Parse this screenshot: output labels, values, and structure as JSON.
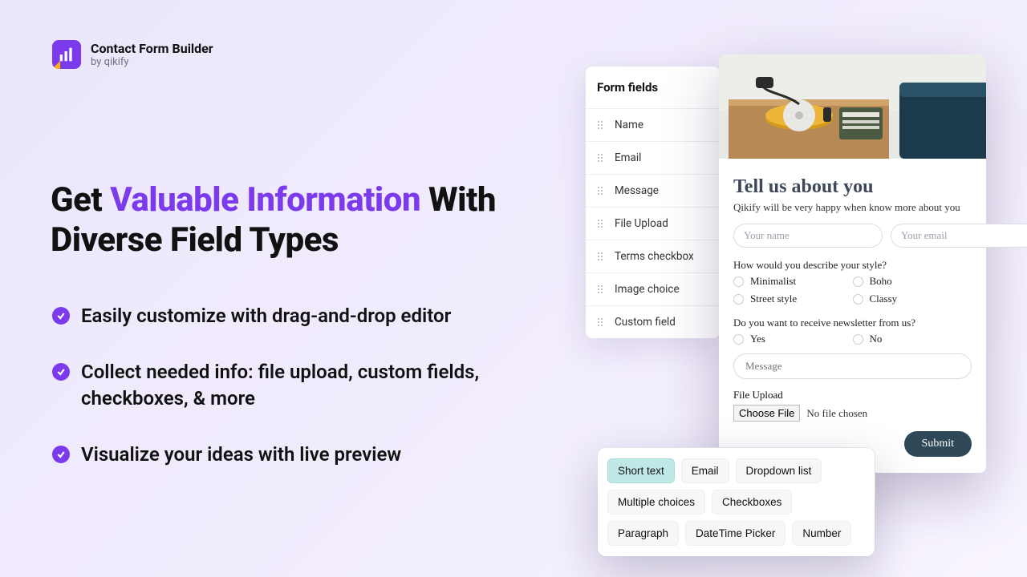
{
  "brand": {
    "title": "Contact Form Builder",
    "subtitle": "by qikify"
  },
  "headline": {
    "pre": "Get ",
    "accent": "Valuable Information",
    "post": " With Diverse Field Types"
  },
  "bullets": [
    "Easily customize with drag-and-drop editor",
    "Collect needed info: file upload, custom fields, checkboxes, & more",
    "Visualize your ideas with live preview"
  ],
  "sidebar": {
    "heading": "Form fields",
    "items": [
      "Name",
      "Email",
      "Message",
      "File Upload",
      "Terms checkbox",
      "Image choice",
      "Custom field"
    ]
  },
  "preview": {
    "title": "Tell us about you",
    "subtitle": "Qikify will be very happy when know more about you",
    "name_placeholder": "Your name",
    "email_placeholder": "Your email",
    "q1": "How would you describe your style?",
    "q1_options": [
      "Minimalist",
      "Boho",
      "Street style",
      "Classy"
    ],
    "q2": "Do you want to receive newsletter from us?",
    "q2_options": [
      "Yes",
      "No"
    ],
    "message_placeholder": "Message",
    "file_label": "File Upload",
    "choose_label": "Choose File",
    "no_file": "No file chosen",
    "submit": "Submit"
  },
  "chips": [
    "Short text",
    "Email",
    "Dropdown list",
    "Multiple choices",
    "Checkboxes",
    "Paragraph",
    "DateTime Picker",
    "Number"
  ],
  "chip_active_index": 0,
  "colors": {
    "accent": "#7c3aed"
  }
}
